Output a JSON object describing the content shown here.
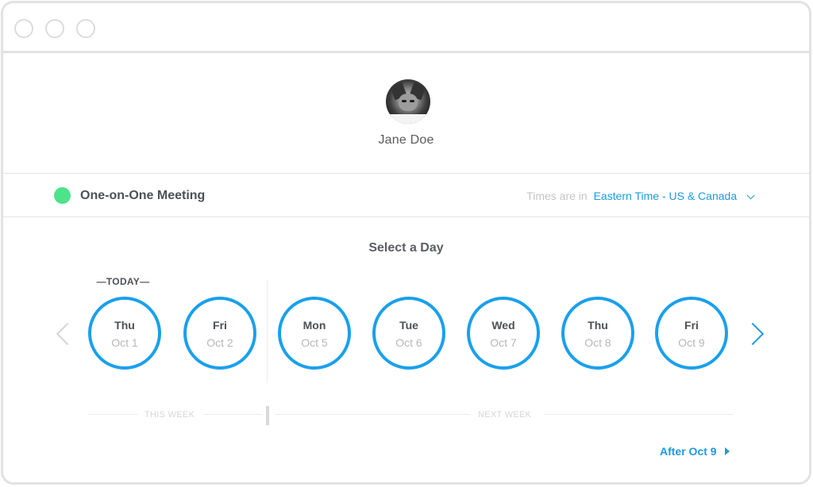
{
  "window": {
    "controls": [
      "close",
      "minimize",
      "maximize"
    ]
  },
  "profile": {
    "avatar_icon": "cat-photo-avatar",
    "name": "Jane Doe"
  },
  "event": {
    "name": "One-on-One Meeting",
    "color": "#4ce38a",
    "timezone_prefix": "Times are in",
    "timezone": "Eastern Time - US & Canada",
    "timezone_icon": "chevron-down-icon"
  },
  "calendar": {
    "title": "Select a Day",
    "today_label": "—TODAY—",
    "accent_color": "#1aa0ec",
    "prev_icon": "chevron-left-icon",
    "next_icon": "chevron-right-icon",
    "days": [
      {
        "dow": "Thu",
        "date": "Oct 1",
        "today": true
      },
      {
        "dow": "Fri",
        "date": "Oct 2"
      },
      {
        "dow": "Mon",
        "date": "Oct 5"
      },
      {
        "dow": "Tue",
        "date": "Oct 6"
      },
      {
        "dow": "Wed",
        "date": "Oct 7"
      },
      {
        "dow": "Thu",
        "date": "Oct 8"
      },
      {
        "dow": "Fri",
        "date": "Oct 9"
      }
    ],
    "week_labels": {
      "this_week": "THIS WEEK",
      "next_week": "NEXT WEEK"
    },
    "after_link": "After Oct 9",
    "after_icon": "caret-right-icon"
  }
}
